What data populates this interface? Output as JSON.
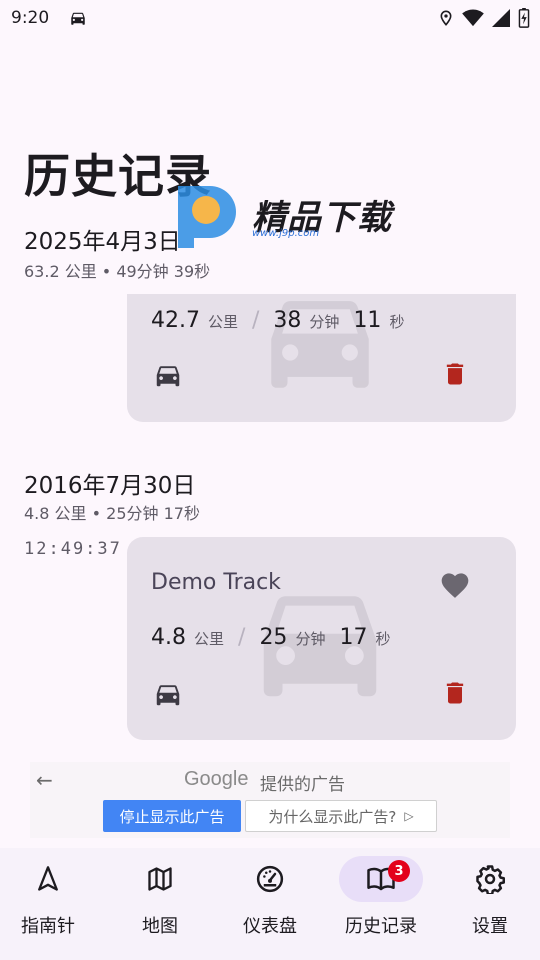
{
  "status_bar": {
    "time": "9:20",
    "icons": [
      "car-icon",
      "location-icon",
      "wifi-icon",
      "signal-icon",
      "battery-charging-icon"
    ]
  },
  "page": {
    "title": "历史记录"
  },
  "watermark": {
    "brand": "精品下载",
    "url": "www.j9p.com"
  },
  "groups": [
    {
      "date": "2025年4月3日",
      "summary": "63.2 公里 • 49分钟 39秒",
      "tracks": [
        {
          "distance": "42.7",
          "distance_unit": "公里",
          "separator": "/",
          "minutes": "38",
          "minutes_unit": "分钟",
          "seconds": "11",
          "seconds_unit": "秒",
          "vehicle_icon": "car-icon",
          "delete_icon": "trash-icon"
        }
      ]
    },
    {
      "date": "2016年7月30日",
      "summary": "4.8 公里 • 25分钟 17秒",
      "tracks": [
        {
          "time": "12:49:37",
          "title": "Demo Track",
          "distance": "4.8",
          "distance_unit": "公里",
          "separator": "/",
          "minutes": "25",
          "minutes_unit": "分钟",
          "seconds": "17",
          "seconds_unit": "秒",
          "favorite_icon": "heart-icon",
          "vehicle_icon": "car-icon",
          "delete_icon": "trash-icon"
        }
      ]
    }
  ],
  "ad": {
    "back": "←",
    "google": "Google",
    "provided": "提供的广告",
    "stop_label": "停止显示此广告",
    "why_label": "为什么显示此广告?",
    "why_icon": "▷"
  },
  "nav": {
    "items": [
      {
        "label": "指南针",
        "icon": "compass-icon"
      },
      {
        "label": "地图",
        "icon": "map-icon"
      },
      {
        "label": "仪表盘",
        "icon": "speedometer-icon"
      },
      {
        "label": "历史记录",
        "icon": "book-icon",
        "badge": "3",
        "active": true
      },
      {
        "label": "设置",
        "icon": "gear-icon"
      }
    ]
  },
  "colors": {
    "background": "#fdf7fd",
    "card": "#e6e0e9",
    "delete": "#b3261e",
    "nav_active": "#e8def8",
    "badge": "#e3001b",
    "ad_button": "#4285f4"
  }
}
